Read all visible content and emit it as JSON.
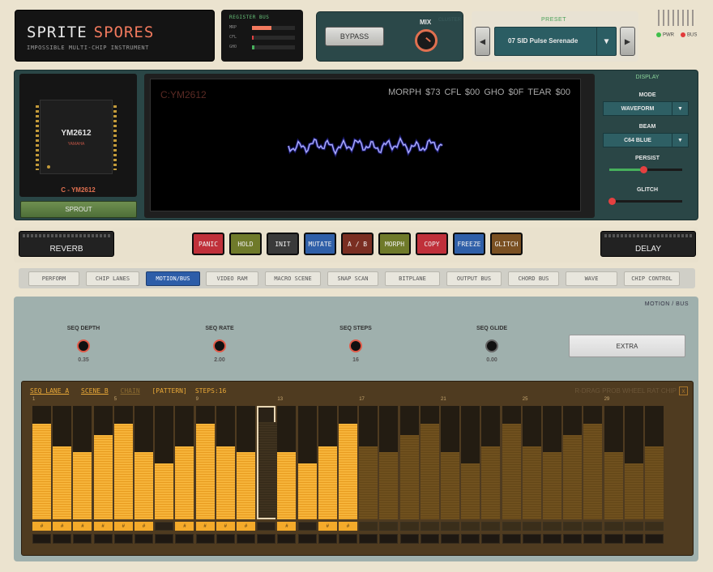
{
  "header": {
    "brand_left": "SPRITE",
    "brand_right": "SPORES",
    "subtitle": "IMPOSSIBLE MULTI-CHIP INSTRUMENT",
    "register_bus": {
      "title": "REGISTER BUS",
      "rows": [
        {
          "label": "MRP",
          "level": 0.45,
          "color": "#f27a5e"
        },
        {
          "label": "CFL",
          "level": 0.04,
          "color": "#e04040"
        },
        {
          "label": "GHO",
          "level": 0.06,
          "color": "#47b05c"
        }
      ]
    },
    "bypass_label": "BYPASS",
    "mix_label": "MIX",
    "mix_sublabel": "CLUSTER",
    "preset_label": "PRESET",
    "preset_value": "07 SID Pulse Serenade",
    "prev_icon": "◀",
    "next_icon": "▶",
    "dropdown_icon": "▼",
    "pwr_label": "PWR",
    "bus_label": "BUS",
    "pwr_color": "#3fbf4a",
    "bus_color": "#e23a3a"
  },
  "display": {
    "chip_name": "YM2612",
    "chip_maker": "YAMAHA",
    "chip_caption": "C - YM2612",
    "sprout_label": "SPROUT",
    "scope_chip": "C:YM2612",
    "scope_readout": "MORPH $73  CFL $00  GHO $0F  TEAR $00",
    "panel_title": "DISPLAY",
    "mode_label": "MODE",
    "mode_value": "WAVEFORM",
    "beam_label": "BEAM",
    "beam_value": "C64 BLUE",
    "persist_label": "PERSIST",
    "persist_level": 0.47,
    "glitch_label": "GLITCH",
    "glitch_level": 0.03
  },
  "fx": {
    "reverb": "REVERB",
    "delay": "DELAY",
    "buttons": [
      {
        "label": "PANIC",
        "color": "#c0303a"
      },
      {
        "label": "HOLD",
        "color": "#6f7a2a"
      },
      {
        "label": "INIT",
        "color": "#3a3a3a"
      },
      {
        "label": "MUTATE",
        "color": "#2f5fa8"
      },
      {
        "label": "A / B",
        "color": "#7a2e22"
      },
      {
        "label": "MORPH",
        "color": "#6f7a2a"
      },
      {
        "label": "COPY",
        "color": "#c0303a"
      },
      {
        "label": "FREEZE",
        "color": "#2f5fa8"
      },
      {
        "label": "GLITCH",
        "color": "#7a5022"
      }
    ]
  },
  "tabs": [
    "PERFORM",
    "CHIP LANES",
    "MOTION/BUS",
    "VIDEO RAM",
    "MACRO SCENE",
    "SNAP SCAN",
    "BITPLANE",
    "OUTPUT BUS",
    "CHORD BUS",
    "WAVE",
    "CHIP CONTROL"
  ],
  "active_tab": 2,
  "seq": {
    "section_title": "MOTION / BUS",
    "knobs": [
      {
        "label": "SEQ DEPTH",
        "value": "0.35"
      },
      {
        "label": "SEQ RATE",
        "value": "2.00"
      },
      {
        "label": "SEQ STEPS",
        "value": "16"
      },
      {
        "label": "SEQ GLIDE",
        "value": "0.00"
      }
    ],
    "extra_label": "EXTRA",
    "header": {
      "lane": "SEQ LANE A",
      "scene": "SCENE B",
      "chain": "CHAIN",
      "pattern": "[PATTERN]",
      "steps": "STEPS:16"
    },
    "hint": "R-DRAG PROB  WHEEL RAT  CHIP",
    "close_icon": "x",
    "step_numbers": [
      "1",
      "5",
      "9",
      "13",
      "17",
      "21",
      "25",
      "29"
    ],
    "values": [
      0.84,
      0.64,
      0.59,
      0.74,
      0.84,
      0.59,
      0.49,
      0.64,
      0.84,
      0.64,
      0.59,
      0.84,
      0.59,
      0.49,
      0.64,
      0.84,
      0.64,
      0.59,
      0.74,
      0.84,
      0.59,
      0.49,
      0.64,
      0.84,
      0.64,
      0.59,
      0.74,
      0.84,
      0.59,
      0.49,
      0.64
    ],
    "selected_step": 11,
    "active_steps": 16,
    "gate_label": "#"
  }
}
